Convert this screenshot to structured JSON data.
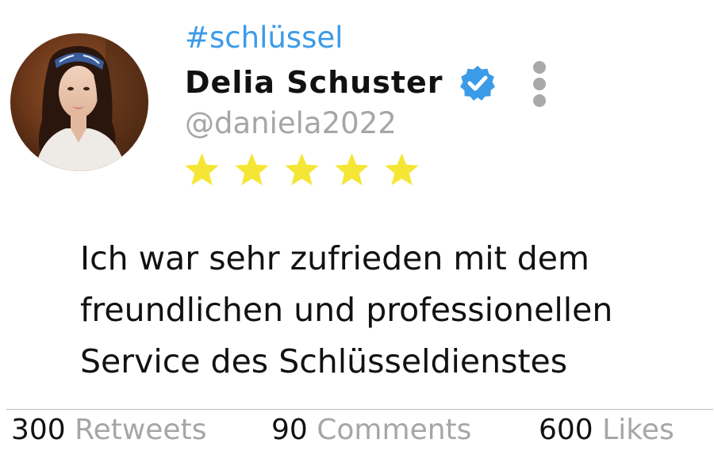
{
  "post": {
    "hashtag": "#schlüssel",
    "author": {
      "name": "Delia Schuster",
      "handle": "@daniela2022",
      "verified": true,
      "avatar": "avatar-photo-woman"
    },
    "rating": {
      "stars": 5,
      "max": 5,
      "color": "#f5e636"
    },
    "text_lines": [
      "Ich war sehr zufrieden mit dem",
      "freundlichen und professionellen",
      "Service des Schlüsseldienstes"
    ],
    "stats": {
      "retweets": {
        "count": "300",
        "label": "Retweets"
      },
      "comments": {
        "count": "90",
        "label": "Comments"
      },
      "likes": {
        "count": "600",
        "label": "Likes"
      }
    }
  },
  "icons": {
    "verified": "verified-badge-icon",
    "menu": "more-vertical-icon",
    "star": "star-icon"
  },
  "colors": {
    "hashtag": "#3b9be8",
    "verified": "#3b9be8",
    "muted": "#a6a6a6",
    "star": "#f5e636",
    "text": "#111111"
  }
}
